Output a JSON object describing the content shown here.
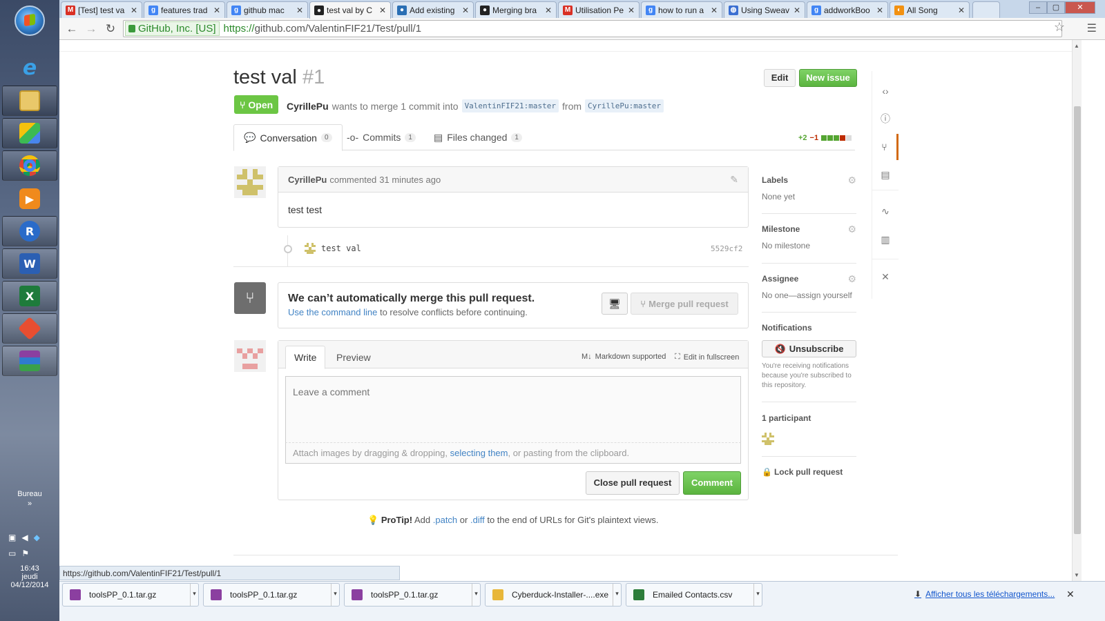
{
  "taskbar": {
    "desktop_label": "Bureau",
    "time": "16:43",
    "day": "jeudi",
    "date": "04/12/2014"
  },
  "browser": {
    "tabs": [
      {
        "title": "[Test] test va",
        "icon": "gmail-icon",
        "color": "#d93025"
      },
      {
        "title": "features trad",
        "icon": "google-icon",
        "color": "#4285f4"
      },
      {
        "title": "github mac",
        "icon": "google-icon",
        "color": "#4285f4"
      },
      {
        "title": "test val by C",
        "icon": "github-icon",
        "color": "#222222",
        "active": true
      },
      {
        "title": "Add existing",
        "icon": "github-help-icon",
        "color": "#2a6fb4"
      },
      {
        "title": "Merging bra",
        "icon": "github-icon",
        "color": "#222222"
      },
      {
        "title": "Utilisation Pe",
        "icon": "gmail-icon",
        "color": "#d93025"
      },
      {
        "title": "how to run a",
        "icon": "google-icon",
        "color": "#4285f4"
      },
      {
        "title": "Using Sweav",
        "icon": "globe-icon",
        "color": "#3b6fd1"
      },
      {
        "title": "addworkBoo",
        "icon": "google-icon",
        "color": "#4285f4"
      },
      {
        "title": "All Song",
        "icon": "songza-icon",
        "color": "#f29111"
      }
    ],
    "ev_label": "GitHub, Inc. [US]",
    "url_scheme": "https://",
    "url_rest": "github.com/ValentinFIF21/Test/pull/1",
    "status_url": "https://github.com/ValentinFIF21/Test/pull/1"
  },
  "pr": {
    "title": "test val",
    "number": "#1",
    "edit_label": "Edit",
    "new_issue_label": "New issue",
    "state": "Open",
    "author": "CyrillePu",
    "merge_text": "wants to merge 1 commit into",
    "base_branch": "ValentinFIF21:master",
    "from_text": "from",
    "head_branch": "CyrillePu:master",
    "tabs": [
      {
        "label": "Conversation",
        "count": "0"
      },
      {
        "label": "Commits",
        "count": "1"
      },
      {
        "label": "Files changed",
        "count": "1"
      }
    ],
    "diffstat": {
      "additions": "+2",
      "deletions": "−1",
      "blocks": [
        "#55a532",
        "#55a532",
        "#55a532",
        "#bd2c00",
        "#dddddd"
      ]
    }
  },
  "comment": {
    "author": "CyrillePu",
    "verb": "commented",
    "time": "31 minutes ago",
    "body": "test test"
  },
  "commit": {
    "message": "test val",
    "sha": "5529cf2"
  },
  "merge": {
    "title": "We can’t automatically merge this pull request.",
    "link_text": "Use the command line",
    "rest_text": "to resolve conflicts before continuing.",
    "button_label": "Merge pull request"
  },
  "new_comment": {
    "write_tab": "Write",
    "preview_tab": "Preview",
    "markdown_label": "Markdown supported",
    "fullscreen_label": "Edit in fullscreen",
    "placeholder": "Leave a comment",
    "attach_prefix": "Attach images by dragging & dropping,",
    "attach_link": "selecting them",
    "attach_suffix": ", or pasting from the clipboard.",
    "close_label": "Close pull request",
    "comment_label": "Comment"
  },
  "protip": {
    "label": "ProTip!",
    "text_a": "Add",
    "patch": ".patch",
    "text_b": "or",
    "diff": ".diff",
    "text_c": "to the end of URLs for Git's plaintext views."
  },
  "sidebar": {
    "labels_title": "Labels",
    "labels_value": "None yet",
    "milestone_title": "Milestone",
    "milestone_value": "No milestone",
    "assignee_title": "Assignee",
    "assignee_value": "No one—assign yourself",
    "notifications_title": "Notifications",
    "unsubscribe_label": "Unsubscribe",
    "notifications_desc": "You're receiving notifications because you're subscribed to this repository.",
    "participants_title": "1 participant",
    "lock_label": "Lock pull request"
  },
  "downloads": {
    "items": [
      "toolsPP_0.1.tar.gz",
      "toolsPP_0.1.tar.gz",
      "toolsPP_0.1.tar.gz",
      "Cyberduck-Installer-....exe",
      "Emailed Contacts.csv"
    ],
    "show_all": "Afficher tous les téléchargements..."
  },
  "colors": {
    "accent_green": "#6cc644",
    "link_blue": "#4183c4",
    "selected_nav": "#d26911"
  }
}
